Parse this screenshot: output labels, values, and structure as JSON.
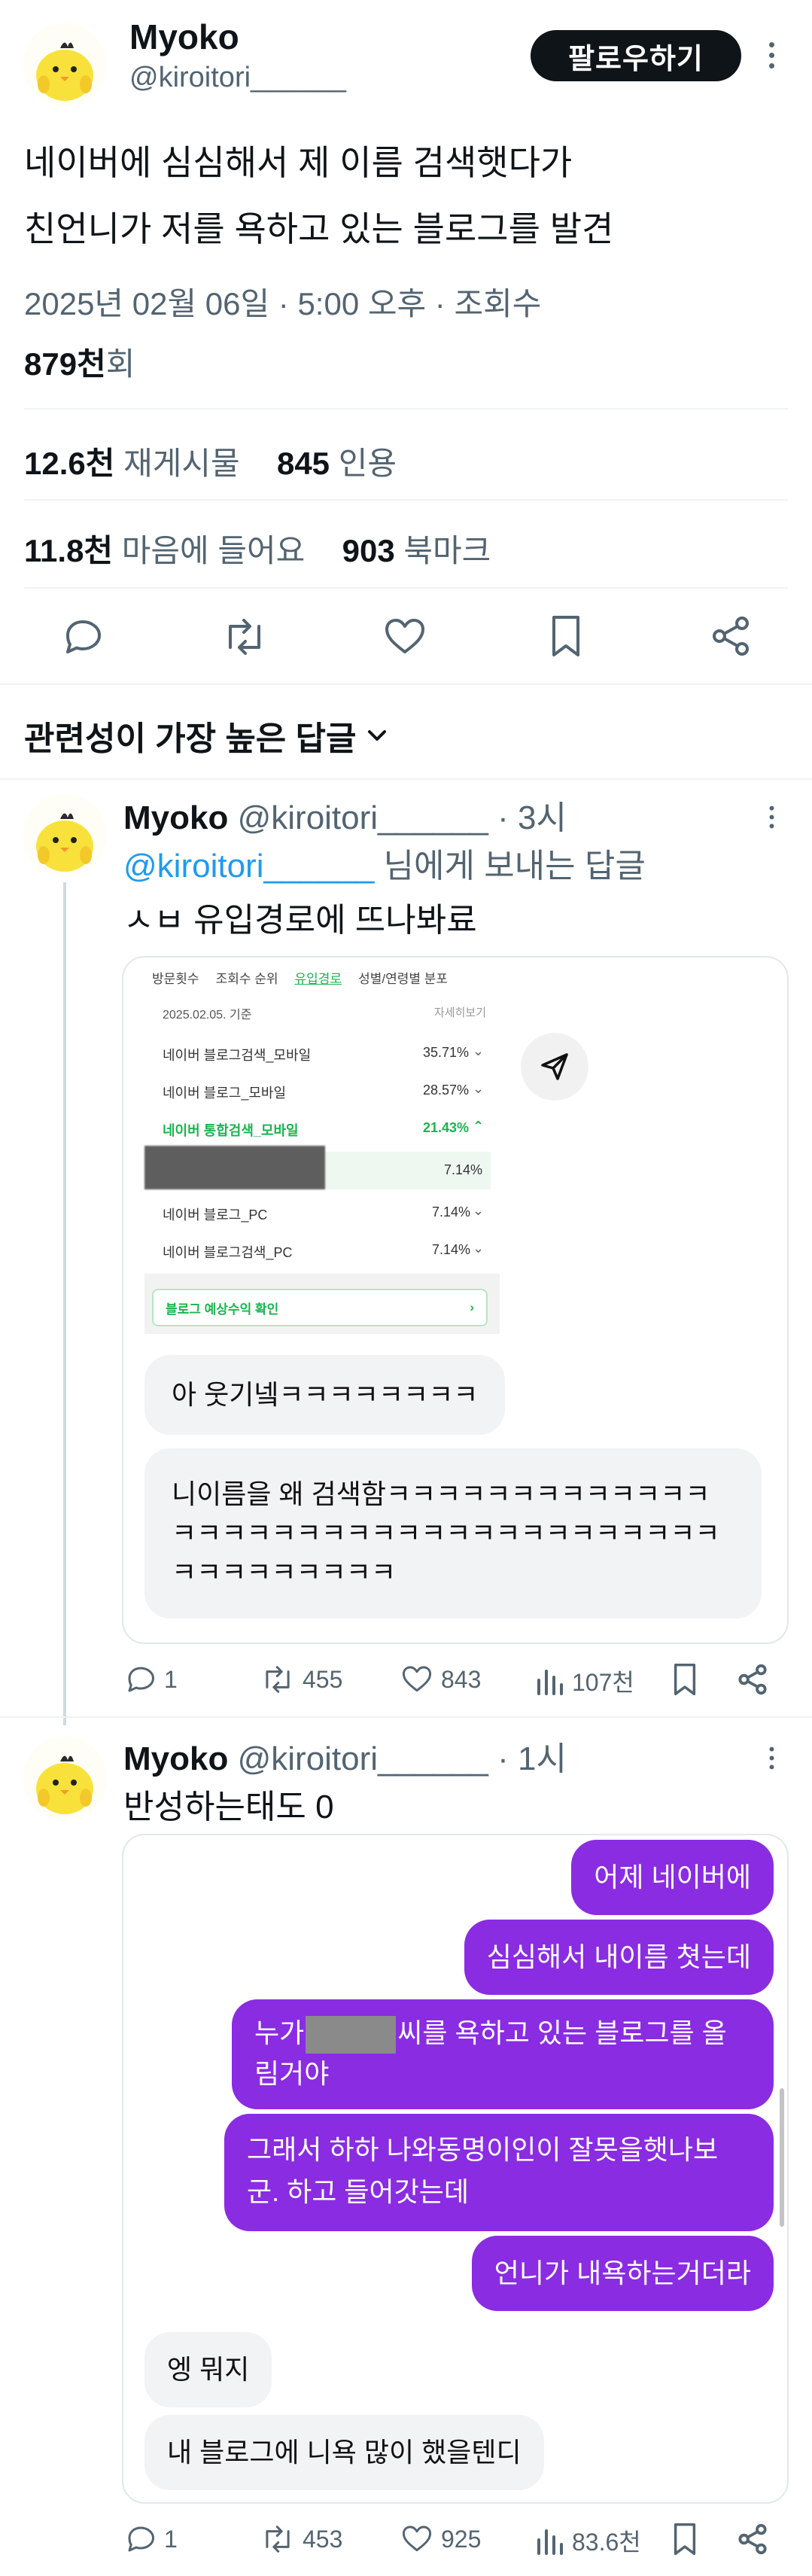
{
  "author": {
    "name": "Myoko",
    "handle": "@kiroitori______"
  },
  "follow_label": "팔로우하기",
  "tweet": {
    "line1": "네이버에 심심해서 제 이름 검색햇다가",
    "line2": "친언니가 저를 욕하고 있는 블로그를 발견",
    "meta_line": "2025년 02월 06일 · 5:00 오후 · 조회수",
    "views_value": "879천",
    "views_suffix": "회",
    "retweets_value": "12.6천",
    "retweets_label": "재게시물",
    "quotes_value": "845",
    "quotes_label": "인용",
    "likes_value": "11.8천",
    "likes_label": "마음에 들어요",
    "bookmarks_value": "903",
    "bookmarks_label": "북마크"
  },
  "replies_sort_label": "관련성이 가장 높은 답글",
  "reply1": {
    "name": "Myoko",
    "handle": "@kiroitori______",
    "time": "· 3시",
    "mention": "@kiroitori______",
    "mention_suffix": "님에게 보내는 답글",
    "text": "ㅅㅂ 유입경로에 뜨나봐료",
    "analytics": {
      "tabs": [
        "방문횟수",
        "조회수 순위",
        "유입경로",
        "성별/연령별 분포"
      ],
      "date": "2025.02.05. 기준",
      "more": "자세히보기",
      "rows": [
        {
          "label": "네이버 블로그검색_모바일",
          "pct": "35.71%"
        },
        {
          "label": "네이버 블로그_모바일",
          "pct": "28.57%"
        },
        {
          "label": "네이버 통합검색_모바일",
          "pct": "21.43%"
        },
        {
          "label": "",
          "pct": "7.14%"
        },
        {
          "label": "네이버 블로그_PC",
          "pct": "7.14%"
        },
        {
          "label": "네이버 블로그검색_PC",
          "pct": "7.14%"
        }
      ],
      "button": "블로그 예상수익 확인"
    },
    "bubble1": "아 웃기넼ㅋㅋㅋㅋㅋㅋㅋㅋ",
    "bubble2": "니이름을 왜 검색함ㅋㅋㅋㅋㅋㅋㅋㅋㅋㅋㅋㅋㅋㅋㅋㅋㅋㅋㅋㅋㅋㅋㅋㅋㅋㅋㅋㅋㅋㅋㅋㅋㅋㅋㅋㅋㅋㅋㅋㅋㅋㅋㅋㅋ",
    "stats": {
      "replies": "1",
      "retweets": "455",
      "likes": "843",
      "views": "107천"
    }
  },
  "reply2": {
    "name": "Myoko",
    "handle": "@kiroitori______",
    "time": "· 1시",
    "text": "반성하는태도 0",
    "chat": {
      "p1": "어제 네이버에",
      "p2": "심심해서 내이름 쳣는데",
      "p3a": "누가",
      "p3b": "씨를 욕하고 있는 블로그를 올",
      "p3c": "림거야",
      "p4a": "그래서 하하 나와동명이인이 잘못을햇나보",
      "p4b": "군. 하고 들어갓는데",
      "p5": "언니가 내욕하는거더라",
      "g1": "엥 뭐지",
      "g2": "내 블로그에 니욕 많이 했을텐디"
    },
    "stats": {
      "replies": "1",
      "retweets": "453",
      "likes": "925",
      "views": "83.6천"
    }
  },
  "colors": {
    "accent": "#1d9bf0",
    "bubble_purple": "#8a2ce2",
    "text": "#0f1419",
    "muted": "#536471"
  }
}
